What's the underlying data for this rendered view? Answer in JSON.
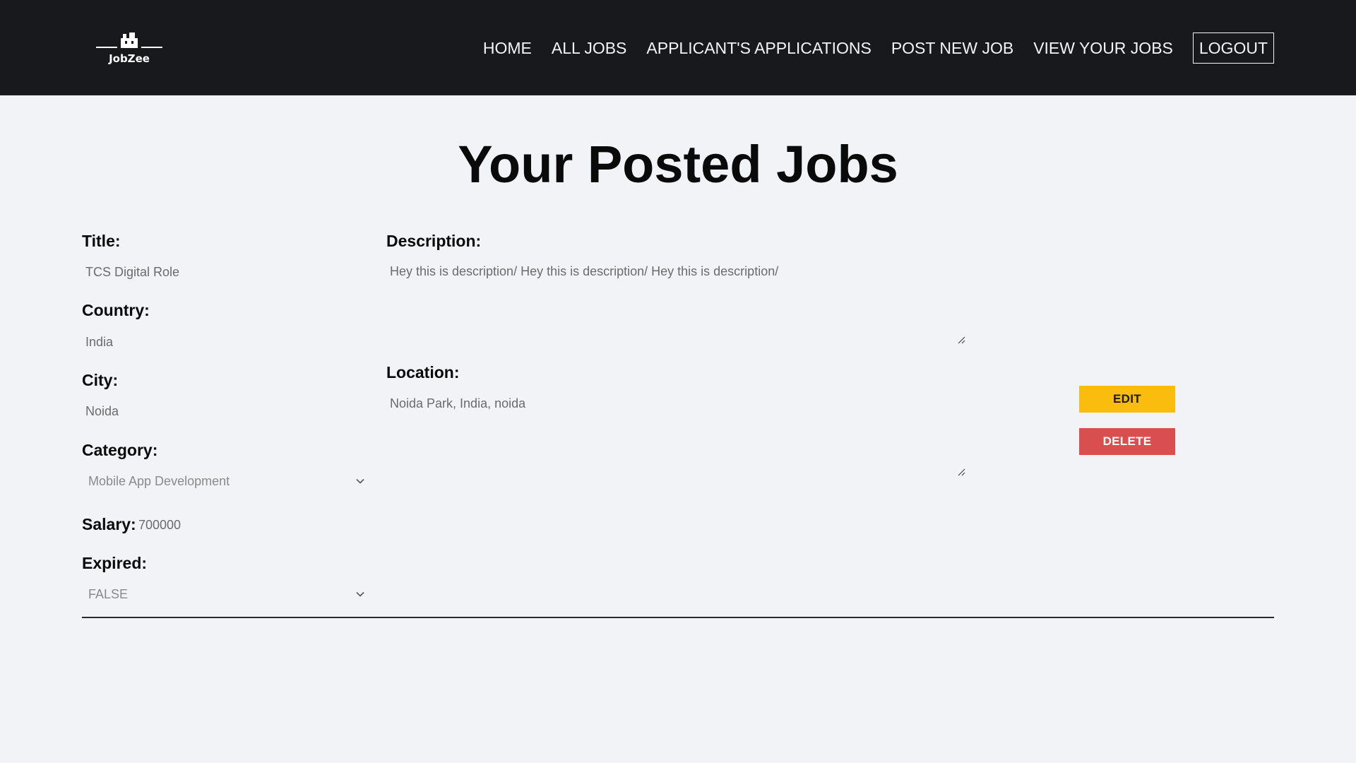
{
  "header": {
    "logo_text": "JobZee",
    "nav": [
      {
        "label": "HOME"
      },
      {
        "label": "ALL JOBS"
      },
      {
        "label": "APPLICANT'S APPLICATIONS"
      },
      {
        "label": "POST NEW JOB"
      },
      {
        "label": "VIEW YOUR JOBS"
      },
      {
        "label": "LOGOUT"
      }
    ]
  },
  "page": {
    "title": "Your Posted Jobs"
  },
  "job": {
    "title_label": "Title:",
    "title_value": "TCS Digital Role",
    "country_label": "Country:",
    "country_value": "India",
    "city_label": "City:",
    "city_value": "Noida",
    "category_label": "Category:",
    "category_value": "Mobile App Development",
    "salary_label": "Salary:",
    "salary_value": "700000",
    "expired_label": "Expired:",
    "expired_value": "FALSE",
    "description_label": "Description:",
    "description_value": "Hey this is description/ Hey this is description/ Hey this is description/",
    "location_label": "Location:",
    "location_value": "Noida Park, India, noida",
    "edit_label": "EDIT",
    "delete_label": "DELETE"
  },
  "colors": {
    "header_bg": "#18191d",
    "page_bg": "#f1f3f6",
    "edit_button": "#fbbd0d",
    "delete_button": "#d94f4f"
  },
  "icons": [
    "logo-icon",
    "chevron-down-icon",
    "resize-grip-icon"
  ]
}
